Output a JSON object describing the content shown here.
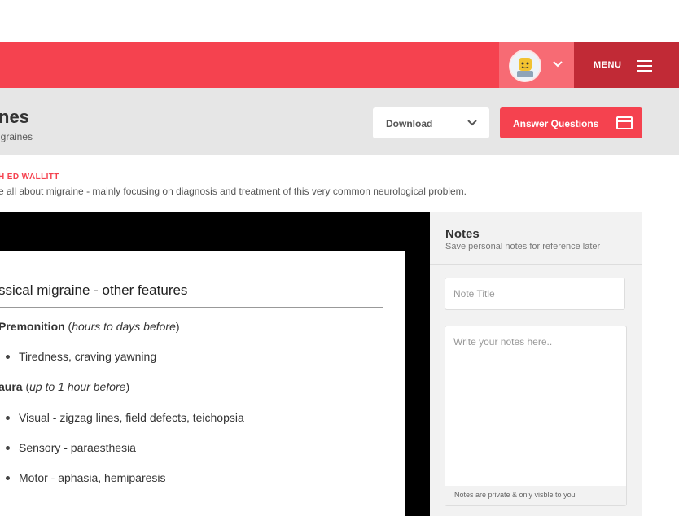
{
  "nav": {
    "menu_label": "MENU"
  },
  "header": {
    "title": "nes",
    "subtitle": "igraines",
    "download_label": "Download",
    "answer_label": "Answer Questions"
  },
  "course": {
    "presenter": "H ED WALLITT",
    "description": "e all about migraine - mainly focusing on diagnosis and treatment of this very common neurological problem."
  },
  "slide": {
    "title": "ssical migraine - other features",
    "lines": [
      {
        "bold": "Premonition",
        "rest_open": " (",
        "italic": "hours to days before",
        "rest_close": ")"
      },
      {
        "bullet": "Tiredness, craving yawning"
      },
      {
        "bold": "aura",
        "rest_open": " (",
        "italic": "up to 1 hour before",
        "rest_close": ")"
      },
      {
        "bullet": "Visual - zigzag lines, field defects, teichopsia"
      },
      {
        "bullet": "Sensory - paraesthesia"
      },
      {
        "bullet": "Motor - aphasia, hemiparesis"
      }
    ]
  },
  "notes": {
    "title": "Notes",
    "subtitle": "Save personal notes for reference later",
    "title_placeholder": "Note Title",
    "body_placeholder": "Write your notes here..",
    "footer": "Notes are private & only visble to you"
  },
  "colors": {
    "brand_red": "#f5424f",
    "menu_dark_red": "#c12a36"
  }
}
